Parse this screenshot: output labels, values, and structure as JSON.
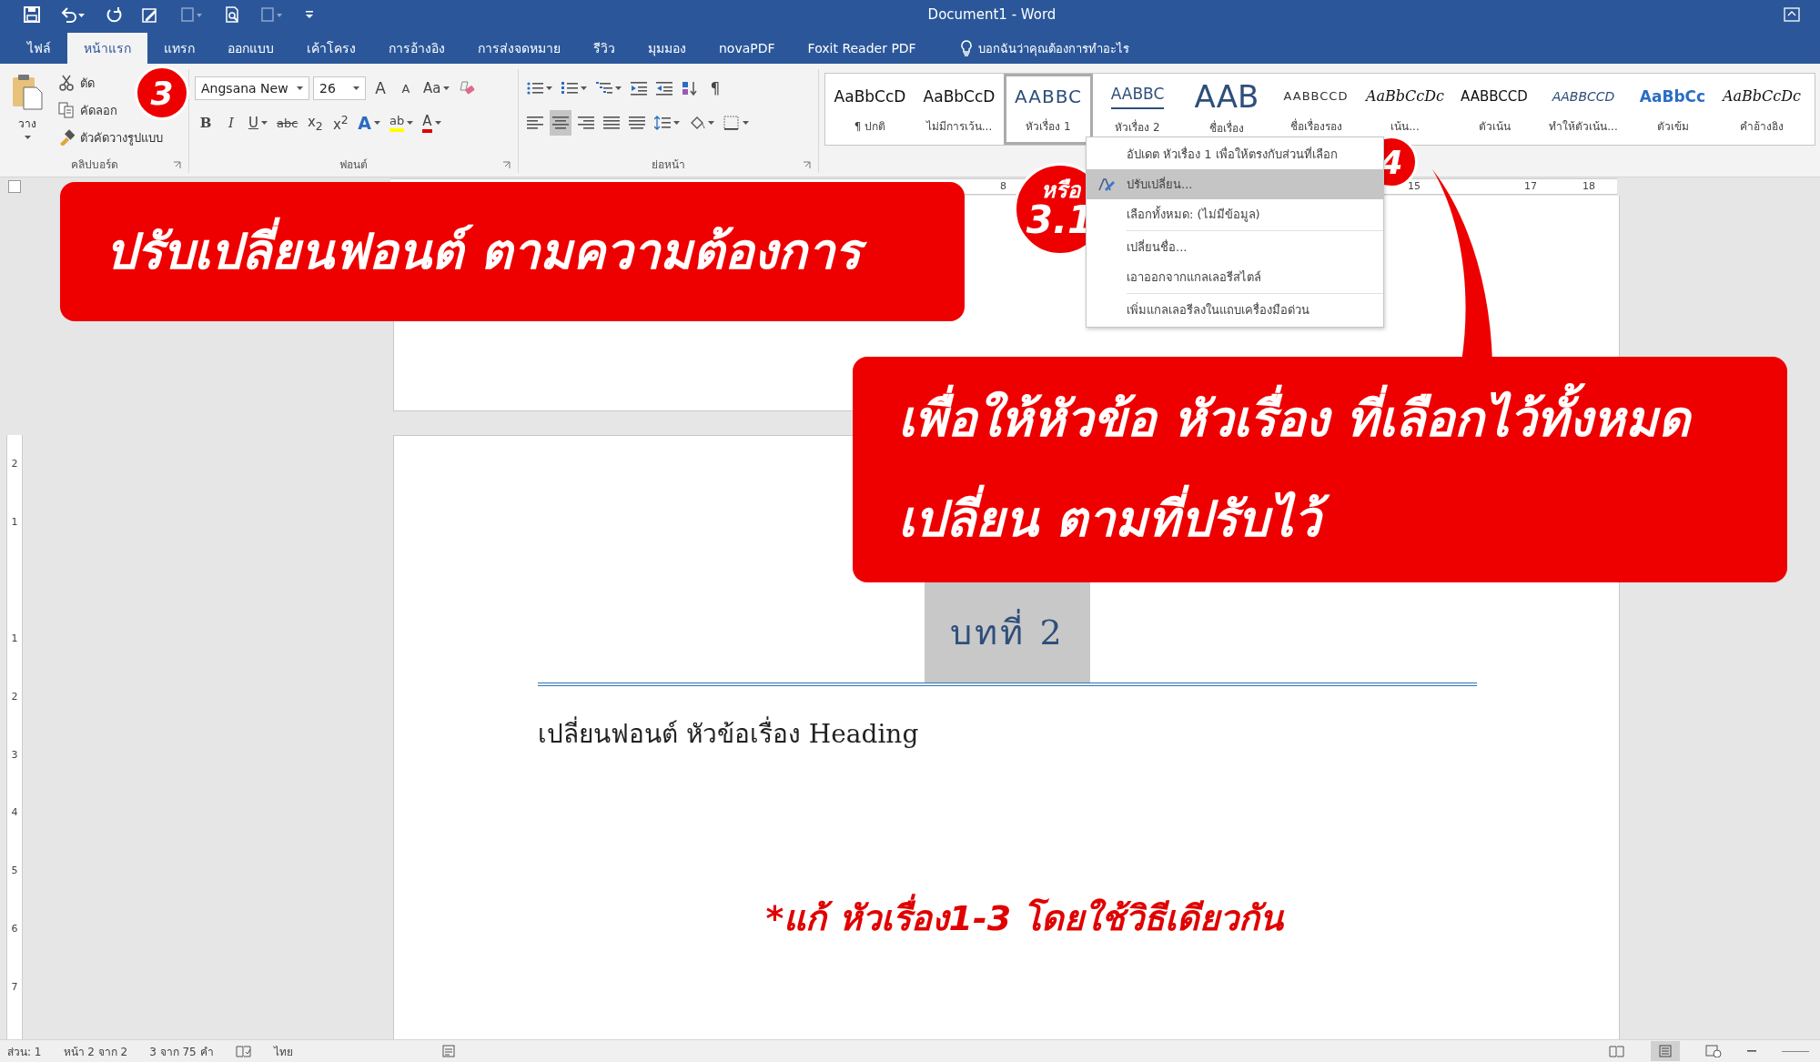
{
  "window": {
    "title": "Document1 - Word"
  },
  "tabs": [
    {
      "label": "ไฟล์",
      "selected": false
    },
    {
      "label": "หน้าแรก",
      "selected": true
    },
    {
      "label": "แทรก",
      "selected": false
    },
    {
      "label": "ออกแบบ",
      "selected": false
    },
    {
      "label": "เค้าโครง",
      "selected": false
    },
    {
      "label": "การอ้างอิง",
      "selected": false
    },
    {
      "label": "การส่งจดหมาย",
      "selected": false
    },
    {
      "label": "รีวิว",
      "selected": false
    },
    {
      "label": "มุมมอง",
      "selected": false
    },
    {
      "label": "novaPDF",
      "selected": false
    },
    {
      "label": "Foxit Reader PDF",
      "selected": false
    }
  ],
  "tell_me": "บอกฉันว่าคุณต้องการทำอะไร",
  "clipboard": {
    "paste": "วาง",
    "items": [
      "ตัด",
      "คัดลอก",
      "ตัวคัดวางรูปแบบ"
    ],
    "label": "คลิปบอร์ด"
  },
  "font": {
    "name": "Angsana New",
    "size": "26",
    "label": "ฟอนต์",
    "size_buttons": [
      {
        "kind": "grow",
        "label": "A"
      },
      {
        "kind": "shrink",
        "label": "A"
      },
      {
        "kind": "case",
        "label": "Aa"
      }
    ],
    "format_buttons": [
      {
        "kind": "bold",
        "label": "B"
      },
      {
        "kind": "italic",
        "label": "I"
      },
      {
        "kind": "underline",
        "label": "U"
      },
      {
        "kind": "strike",
        "label": "abc"
      },
      {
        "kind": "sub",
        "label": "x$_{2}$"
      },
      {
        "kind": "sup",
        "label": "x$^{2}$"
      },
      {
        "kind": "effects",
        "label": "A"
      },
      {
        "kind": "highlight",
        "label": "ab"
      },
      {
        "kind": "color",
        "label": "A"
      }
    ]
  },
  "paragraph": {
    "pilcrow": "¶",
    "label": "ย่อหน้า",
    "align_buttons": [
      {
        "kind": "left",
        "selected": false
      },
      {
        "kind": "center",
        "selected": true
      },
      {
        "kind": "right",
        "selected": false
      },
      {
        "kind": "justify",
        "selected": false
      },
      {
        "kind": "distributed",
        "selected": false
      }
    ]
  },
  "styles": [
    {
      "preview": "AaBbCcD",
      "name": "¶ ปกติ",
      "kind": "normal",
      "selected": false
    },
    {
      "preview": "AaBbCcD",
      "name": "ไม่มีการเว้น...",
      "kind": "normal",
      "selected": false
    },
    {
      "preview": "AABBC",
      "name": "หัวเรื่อง 1",
      "kind": "heading",
      "selected": true
    },
    {
      "preview": "AABBC",
      "name": "หัวเรื่อง 2",
      "kind": "heading2",
      "selected": false
    },
    {
      "preview": "AAB",
      "name": "ชื่อเรื่อง",
      "kind": "title",
      "selected": false
    },
    {
      "preview": "AABBCCD",
      "name": "ชื่อเรื่องรอง",
      "kind": "subtitle",
      "selected": false
    },
    {
      "preview": "AaBbCcDc",
      "name": "เน้น...",
      "kind": "italic",
      "selected": false
    },
    {
      "preview": "AABBCCD",
      "name": "ตัวเน้น",
      "kind": "caps",
      "selected": false
    },
    {
      "preview": "AABBCCD",
      "name": "ทำให้ตัวเน้น...",
      "kind": "caps-italic",
      "selected": false
    },
    {
      "preview": "AaBbCc",
      "name": "ตัวเข้ม",
      "kind": "strong",
      "selected": false
    },
    {
      "preview": "AaBbCcDc",
      "name": "คำอ้างอิง",
      "kind": "italic",
      "selected": false
    }
  ],
  "context_menu": [
    {
      "kind": "item",
      "label": "อัปเดต หัวเรื่อง 1 เพื่อให้ตรงกับส่วนที่เลือก",
      "selected": false
    },
    {
      "kind": "item",
      "label": "ปรับเปลี่ยน...",
      "selected": true
    },
    {
      "kind": "item",
      "label": "เลือกทั้งหมด: (ไม่มีข้อมูล)",
      "selected": false
    },
    {
      "kind": "separator"
    },
    {
      "kind": "item",
      "label": "เปลี่ยนชื่อ...",
      "selected": false
    },
    {
      "kind": "item",
      "label": "เอาออกจากแกลเลอรีสไตล์",
      "selected": false
    },
    {
      "kind": "separator"
    },
    {
      "kind": "item",
      "label": "เพิ่มแกลเลอรีลงในแถบเครื่องมือด่วน",
      "selected": false
    }
  ],
  "ruler": {
    "numbers": [
      "8",
      "15",
      "17",
      "18"
    ],
    "vertical_numbers": [
      "2",
      "1",
      "1",
      "2",
      "3",
      "4",
      "5",
      "6",
      "7"
    ]
  },
  "document": {
    "heading": {
      "text": "บทที่ 2",
      "selected": true
    },
    "body": "เปลี่ยนฟอนต์ หัวข้อเรื่อง Heading"
  },
  "annotations": {
    "step3": "3",
    "step4": "4",
    "alt_prefix": "หรือ",
    "alt_number": "3.1",
    "callout_font": "ปรับเปลี่ยนฟอนต์ ตามความต้องการ",
    "callout_apply": "เพื่อให้หัวข้อ หัวเรื่อง ที่เลือกไว้ทั้งหมด\nเปลี่ยน ตามที่ปรับไว้",
    "note": "*แก้ หัวเรื่อง1-3 โดยใช้วิธีเดียวกัน"
  },
  "status_bar": {
    "section": "ส่วน: 1",
    "page": "หน้า 2 จาก 2",
    "words": "3 จาก 75 คำ",
    "language": "ไทย"
  }
}
